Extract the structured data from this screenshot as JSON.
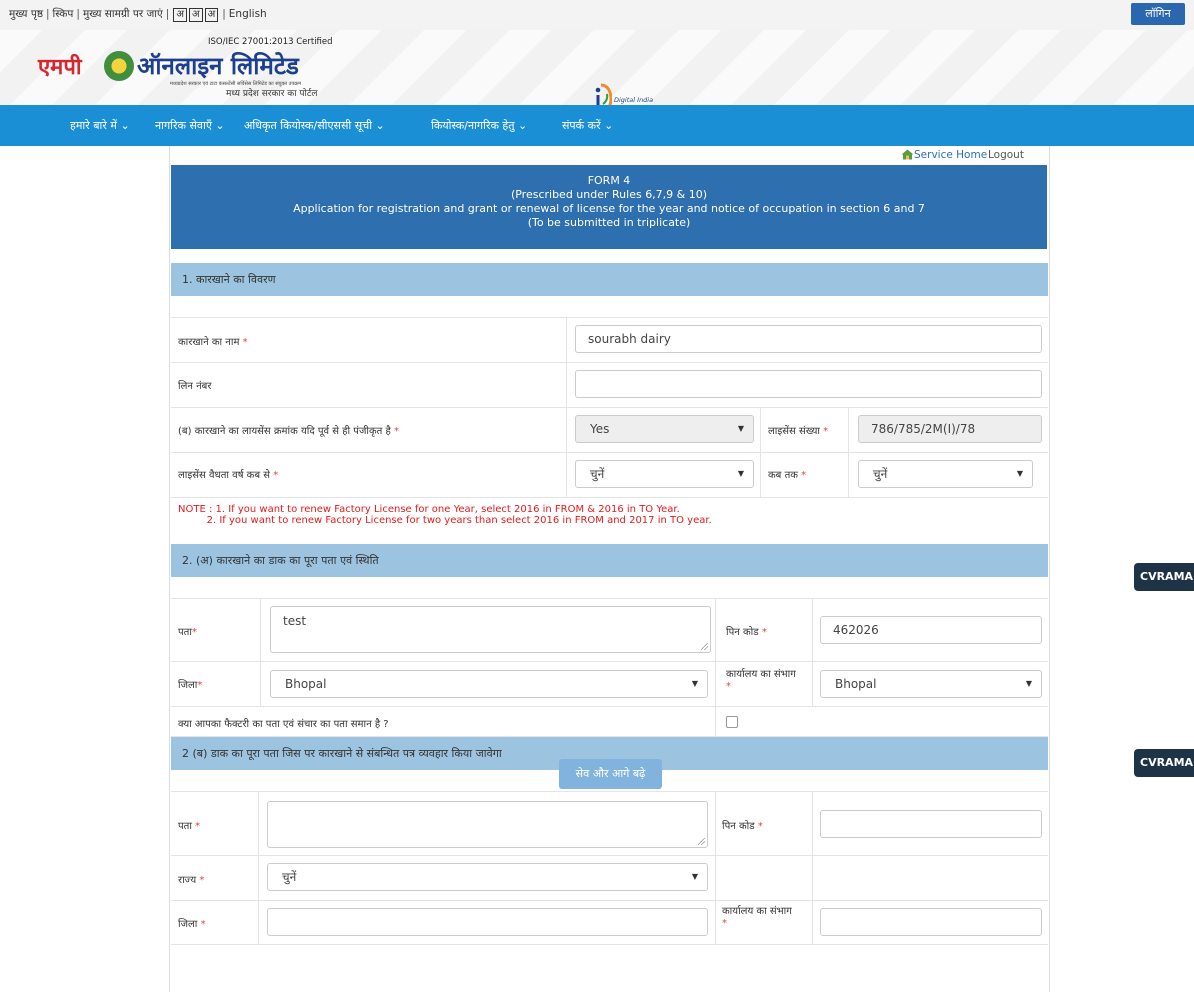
{
  "top": {
    "links": [
      "मुख्य पृष्ठ",
      "स्किप",
      "मुख्य सामग्री पर जाएं"
    ],
    "font_sizes": [
      "अ",
      "अ",
      "अ"
    ],
    "language": "English",
    "login": "लॉगिन"
  },
  "header": {
    "iso": "ISO/IEC 27001:2013 Certified",
    "logo_red": "एमपी",
    "logo_blue": "ऑनलाइन लिमिटेड",
    "logo_small": "मध्यप्रदेश सरकार एवं टाटा कंसल्टेंसी सर्विसेस लिमिटेड का संयुक्त उपक्रम",
    "logo_sub": "मध्य प्रदेश सरकार का पोर्टल",
    "digital_india": "Digital India"
  },
  "nav": [
    "हमारे बारे में",
    "नागरिक सेवाएँ",
    "अधिकृत कियोस्क/सीएससी सूची",
    "कियोस्क/नागरिक हेतु",
    "संपर्क करें"
  ],
  "service": {
    "home": "Service Home",
    "logout": "Logout"
  },
  "form_title": {
    "line1": "FORM 4",
    "line2": "(Prescribed under Rules 6,7,9 & 10)",
    "line3": "Application for registration and grant or renewal of license for the year and notice of occupation in section 6 and 7",
    "line4": "(To be submitted in triplicate)"
  },
  "section1": {
    "heading": "1. कारखाने का विवरण",
    "factory_name_label": "कारखाने का नाम",
    "factory_name_value": "sourabh dairy",
    "lin_label": "लिन नंबर",
    "lin_value": "",
    "registered_label": "(ब) कारखाने का लायसेंस क्रमांक यदि पूर्व से ही पंजीकृत है",
    "registered_value": "Yes",
    "license_no_label": "लाइसेंस संख्या",
    "license_no_value": "786/785/2M(I)/78",
    "validity_from_label": "लाइसेंस वैधता वर्ष कब से",
    "validity_from_value": "चुनें",
    "validity_to_label": "कब तक",
    "validity_to_value": "चुनें"
  },
  "note": {
    "line1": "NOTE : 1. If you want to renew Factory License for one Year, select 2016 in FROM & 2016 in TO Year.",
    "line2": "         2. If you want to renew Factory License for two years than select 2016 in FROM and 2017 in TO year."
  },
  "section2a": {
    "heading": "2. (अ) कारखाने का डाक का पूरा पता एवं स्थिति",
    "address_label": "पता",
    "address_value": "test",
    "pincode_label": "पिन कोड",
    "pincode_value": "462026",
    "district_label": "जिला",
    "district_value": "Bhopal",
    "office_label": "कार्यालय का संभाग",
    "office_value": "Bhopal",
    "same_address_label": "क्या आपका फैक्टरी का पता एवं संचार का पता समान है ?"
  },
  "section2b": {
    "heading": "2 (ब) डाक का पूरा पता जिस पर कारखाने से संबन्धित पत्र व्यवहार किया जावेगा",
    "address_label": "पता",
    "pincode_label": "पिन कोड",
    "state_label": "राज्य",
    "state_value": "चुनें",
    "district_label": "जिला",
    "office_label": "कार्यालय का संभाग"
  },
  "save_button": "सेव और आगे बढ़े",
  "side_tabs": [
    "CVRAMA",
    "CVRAMA"
  ],
  "colors": {
    "nav": "#1a8fd5",
    "title": "#2e6fb0",
    "section": "#9cc4e1",
    "required": "#e04444",
    "note": "#e21b1b"
  }
}
